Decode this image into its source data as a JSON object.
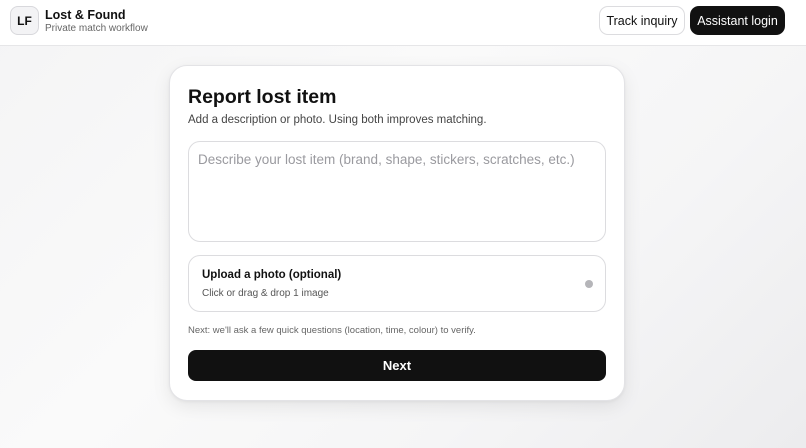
{
  "header": {
    "logo_text": "LF",
    "title": "Lost & Found",
    "subtitle": "Private match workflow",
    "track_label": "Track inquiry",
    "login_label": "Assistant login"
  },
  "form": {
    "title": "Report lost item",
    "subtitle": "Add a description or photo. Using both improves matching.",
    "description": {
      "value": "",
      "placeholder": "Describe your lost item (brand, shape, stickers, scratches, etc.)"
    },
    "upload": {
      "title": "Upload a photo (optional)",
      "subtitle": "Click or drag & drop 1 image",
      "status_icon": "status-dot-icon"
    },
    "hint": "Next: we'll ask a few quick questions (location, time, colour) to verify.",
    "next_label": "Next"
  },
  "colors": {
    "primary_button": "#111111",
    "background": "#f4f4f5"
  }
}
